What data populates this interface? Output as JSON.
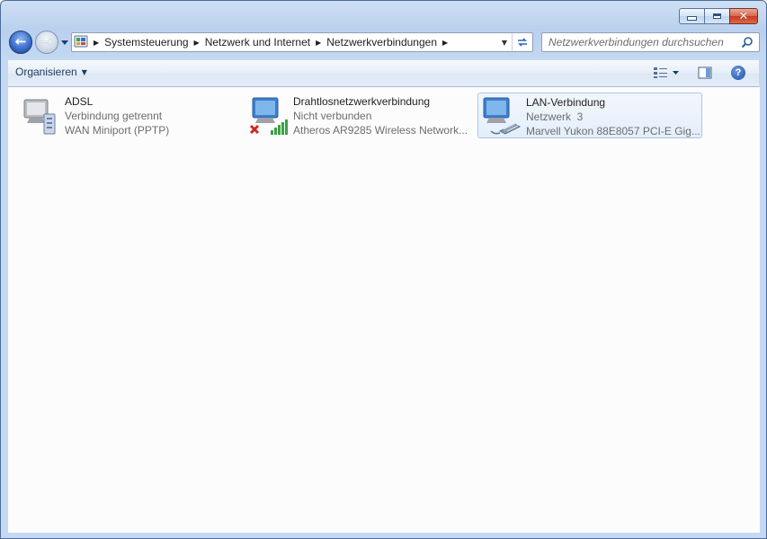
{
  "window": {
    "caption_buttons": {
      "minimize": "minimize-icon",
      "maximize": "maximize-icon",
      "close": "close-icon"
    }
  },
  "address_bar": {
    "breadcrumbs": [
      "Systemsteuerung",
      "Netzwerk und Internet",
      "Netzwerkverbindungen"
    ]
  },
  "search": {
    "placeholder": "Netzwerkverbindungen durchsuchen"
  },
  "toolbar": {
    "organize_label": "Organisieren",
    "help_label": "?"
  },
  "connections": [
    {
      "name": "ADSL",
      "status": "Verbindung getrennt",
      "device": "WAN Miniport (PPTP)",
      "icon": "modem-connection-icon"
    },
    {
      "name": "Drahtlosnetzwerkverbindung",
      "status": "Nicht verbunden",
      "device": "Atheros AR9285 Wireless Network...",
      "icon": "wireless-connection-icon"
    },
    {
      "name": "LAN-Verbindung",
      "status": "Netzwerk  3",
      "device": "Marvell Yukon 88E8057 PCI-E Gig...",
      "icon": "lan-connection-icon",
      "selected": true
    }
  ],
  "colors": {
    "frame": "#c4d8f1",
    "accent": "#1c4fa5",
    "close_button": "#c7391d",
    "selection": "#e3eefb"
  }
}
